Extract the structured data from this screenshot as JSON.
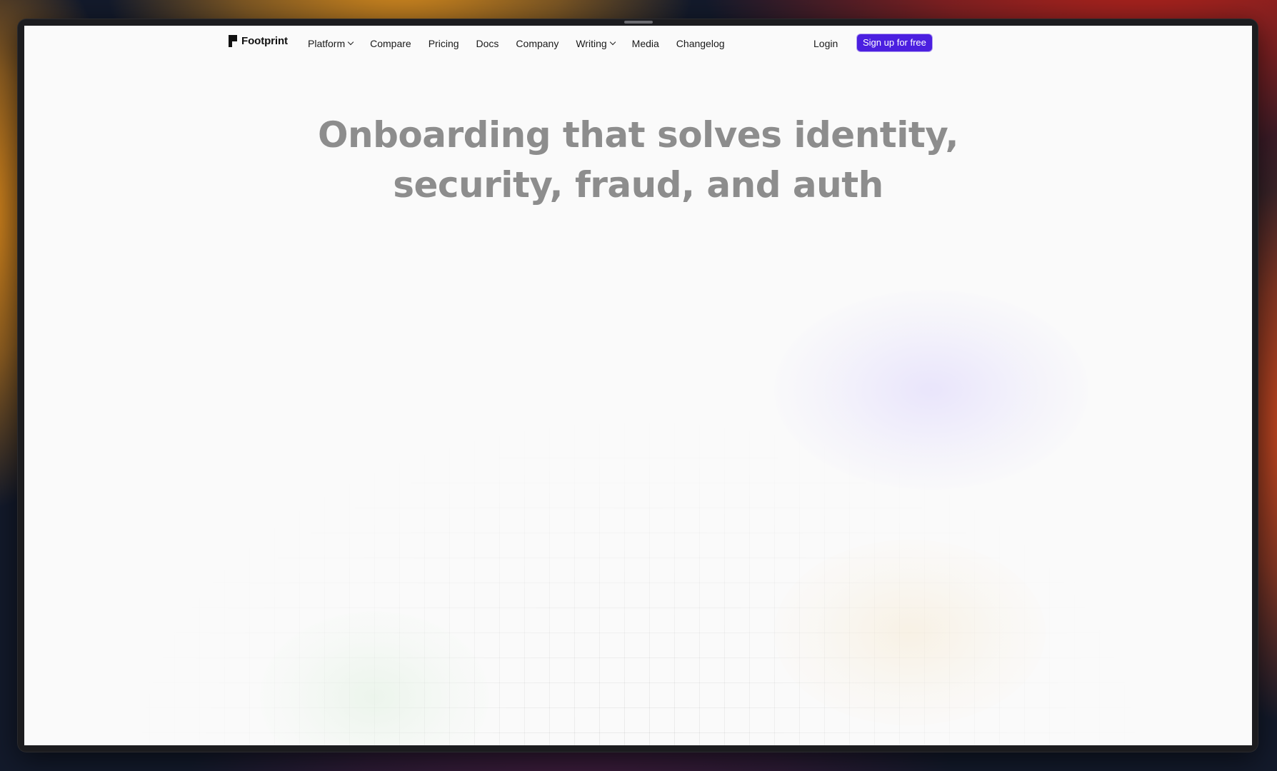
{
  "nav": {
    "logo_text": "Footprint",
    "links": [
      {
        "label": "Platform",
        "has_dropdown": true
      },
      {
        "label": "Compare",
        "has_dropdown": false
      },
      {
        "label": "Pricing",
        "has_dropdown": false
      },
      {
        "label": "Docs",
        "has_dropdown": false
      },
      {
        "label": "Company",
        "has_dropdown": false
      },
      {
        "label": "Writing",
        "has_dropdown": true
      },
      {
        "label": "Media",
        "has_dropdown": false
      },
      {
        "label": "Changelog",
        "has_dropdown": false
      }
    ],
    "login_label": "Login",
    "signup_label": "Sign up for free"
  },
  "hero": {
    "title_line1": "Onboarding that solves identity,",
    "title_line2": "security, fraud, and auth"
  },
  "colors": {
    "accent": "#4b1fe0",
    "page_bg": "#fafafa",
    "title_text": "#8d8d8d"
  }
}
